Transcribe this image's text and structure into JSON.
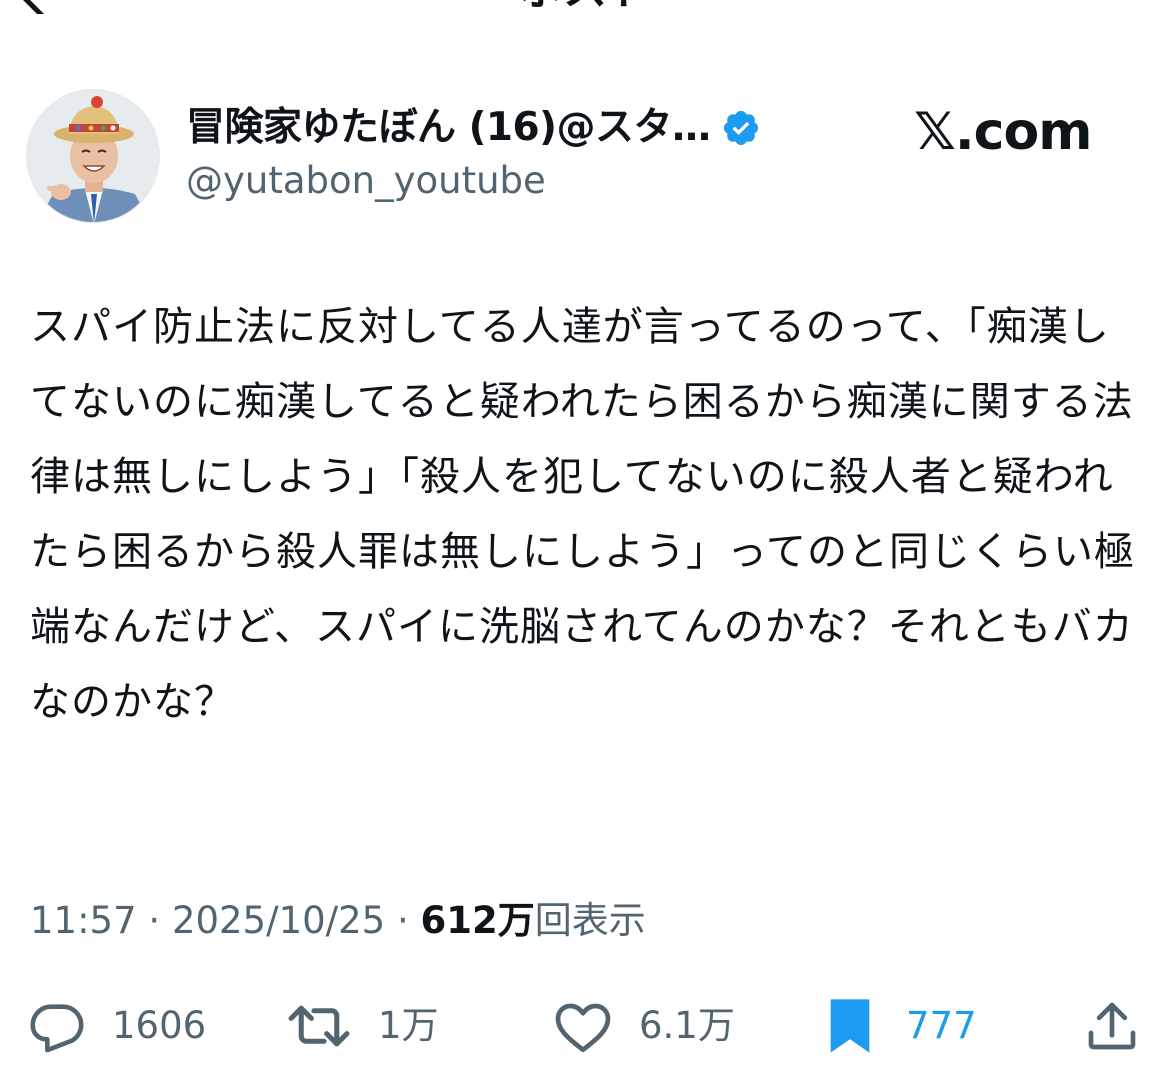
{
  "nav": {
    "title": "ポスト",
    "back_icon": "chevron-left-icon"
  },
  "author": {
    "display_name": "冒険家ゆたぼん (16)@スタ…",
    "handle": "@yutabon_youtube",
    "verified": true,
    "verified_color": "#1d9bf0"
  },
  "brand": {
    "label": "𝕏.com"
  },
  "tweet": {
    "text": "スパイ防止法に反対してる人達が言ってるのって、「痴漢してないのに痴漢してると疑われたら困るから痴漢に関する法律は無しにしよう」「殺人を犯してないのに殺人者と疑われたら困るから殺人罪は無しにしよう」ってのと同じくらい極端なんだけど、スパイに洗脳されてんのかな？それともバカなのかな？"
  },
  "meta": {
    "time": "11:57",
    "separator1": " · ",
    "date": "2025/10/25",
    "separator2": " · ",
    "views_count": "612万",
    "views_label": "回表示"
  },
  "actions": {
    "reply": {
      "icon": "reply-icon",
      "count": "1606"
    },
    "repost": {
      "icon": "repost-icon",
      "count": "1万"
    },
    "like": {
      "icon": "heart-icon",
      "count": "6.1万"
    },
    "bookmark": {
      "icon": "bookmark-icon",
      "count": "777",
      "active_color": "#1d9bf0"
    },
    "share": {
      "icon": "share-icon"
    }
  }
}
